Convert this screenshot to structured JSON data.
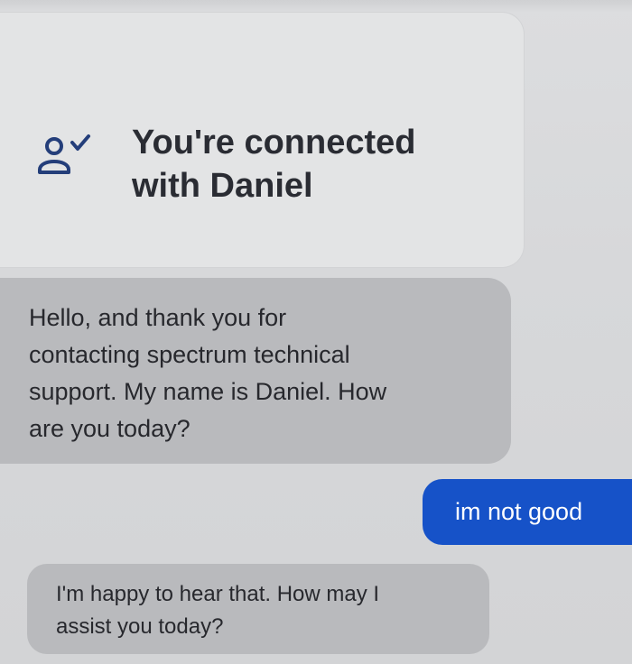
{
  "connection": {
    "line1": "You're connected",
    "line2": "with Daniel",
    "icon": "person-check-icon"
  },
  "messages": [
    {
      "sender": "agent",
      "lines": [
        "Hello, and thank you for",
        "contacting spectrum technical",
        "support. My name is Daniel. How",
        "are you today?"
      ]
    },
    {
      "sender": "user",
      "text": "im not good"
    },
    {
      "sender": "agent",
      "lines": [
        "I'm happy to hear that. How may I",
        "assist you today?"
      ]
    }
  ],
  "colors": {
    "user_bubble": "#1652c8",
    "agent_bubble": "#b9babd",
    "card": "#e3e4e5",
    "text": "#2a2c33"
  }
}
